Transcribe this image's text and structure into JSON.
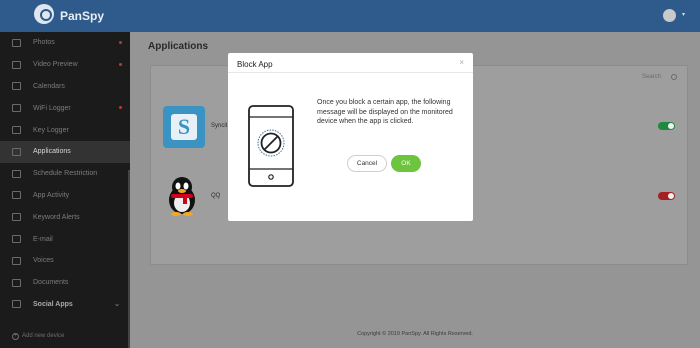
{
  "brand": {
    "name": "PanSpy"
  },
  "sidebar": {
    "items": [
      {
        "label": "Photos",
        "icon": "image-icon",
        "dot": true
      },
      {
        "label": "Video Preview",
        "icon": "video-icon",
        "dot": true
      },
      {
        "label": "Calendars",
        "icon": "calendar-icon",
        "dot": false
      },
      {
        "label": "WiFi Logger",
        "icon": "wifi-icon",
        "dot": true
      },
      {
        "label": "Key Logger",
        "icon": "keyboard-icon",
        "dot": false
      },
      {
        "label": "Applications",
        "icon": "grid-icon",
        "dot": false,
        "active": true
      },
      {
        "label": "Schedule Restriction",
        "icon": "hourglass-icon",
        "dot": false
      },
      {
        "label": "App Activity",
        "icon": "shield-icon",
        "dot": false
      },
      {
        "label": "Keyword Alerts",
        "icon": "bell-icon",
        "dot": false
      },
      {
        "label": "E-mail",
        "icon": "mail-icon",
        "dot": false
      },
      {
        "label": "Voices",
        "icon": "speaker-icon",
        "dot": false
      },
      {
        "label": "Documents",
        "icon": "folder-icon",
        "dot": false
      }
    ],
    "social_label": "Social Apps",
    "add_device": "Add new device"
  },
  "main": {
    "page_title": "Applications",
    "search_placeholder": "Search",
    "apps": [
      {
        "name": "Syncit",
        "enabled": true
      },
      {
        "name": "QQ",
        "enabled": false
      }
    ],
    "footer": "Copyright © 2019 PanSpy. All Rights Reserved."
  },
  "modal": {
    "title": "Block App",
    "close": "×",
    "message": "Once you block a certain app, the following message will be displayed on the monitored device when the app is clicked.",
    "cancel_label": "Cancel",
    "ok_label": "OK"
  },
  "colors": {
    "topbar": "#2f5a8c",
    "sidebar": "#1b1b1b",
    "ok_button": "#6dc43d",
    "toggle_on": "#1f8a3f",
    "toggle_off": "#a52020"
  }
}
